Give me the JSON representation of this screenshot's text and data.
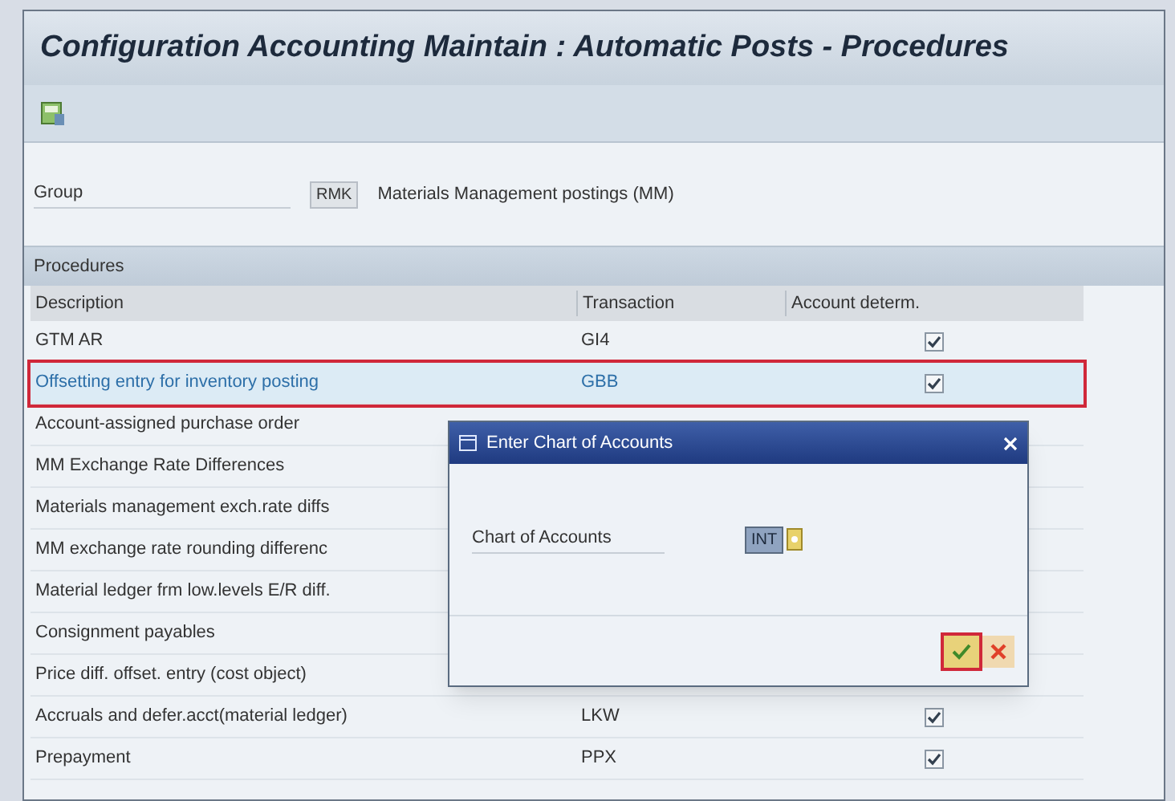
{
  "window": {
    "title": "Configuration Accounting Maintain : Automatic Posts - Procedures"
  },
  "group": {
    "label": "Group",
    "value": "RMK",
    "description": "Materials Management postings (MM)"
  },
  "procedures": {
    "title": "Procedures",
    "columns": [
      "Description",
      "Transaction",
      "Account determ."
    ],
    "rows": [
      {
        "description": "GTM AR",
        "transaction": "GI4",
        "checked": true,
        "selected": false
      },
      {
        "description": "Offsetting entry for inventory posting",
        "transaction": "GBB",
        "checked": true,
        "selected": true
      },
      {
        "description": "Account-assigned purchase order",
        "selected": false
      },
      {
        "description": "MM Exchange Rate Differences",
        "selected": false
      },
      {
        "description": "Materials management exch.rate diffs",
        "selected": false
      },
      {
        "description": "MM exchange rate rounding differenc",
        "selected": false
      },
      {
        "description": "Material ledger frm low.levels E/R diff.",
        "selected": false
      },
      {
        "description": "Consignment payables",
        "selected": false
      },
      {
        "description": "Price diff. offset. entry (cost object)",
        "selected": false
      },
      {
        "description": "Accruals and defer.acct(material ledger)",
        "transaction": "LKW",
        "checked": true,
        "selected": false
      },
      {
        "description": "Prepayment",
        "transaction": "PPX",
        "checked": true,
        "selected": false
      }
    ]
  },
  "dialog": {
    "title": "Enter Chart of Accounts",
    "field_label": "Chart of Accounts",
    "field_value": "INT",
    "ok_highlighted": true
  }
}
